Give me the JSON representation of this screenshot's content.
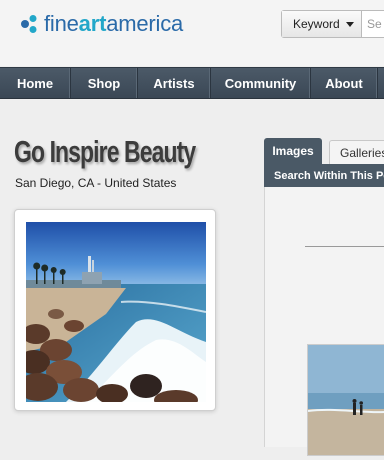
{
  "brand": {
    "part1": "fine",
    "part2": "art",
    "part3": "america",
    "colors": {
      "primary": "#2a6aa8",
      "accent": "#22a7c9"
    },
    "icon": "logo-dots-icon"
  },
  "search": {
    "dropdown_label": "Keyword",
    "dropdown_icon": "caret-down-icon",
    "placeholder": "Se"
  },
  "nav": {
    "items": [
      {
        "label": "Home"
      },
      {
        "label": "Shop"
      },
      {
        "label": "Artists"
      },
      {
        "label": "Community"
      },
      {
        "label": "About"
      }
    ],
    "bg": "#3f4c5a"
  },
  "profile": {
    "name": "Go Inspire Beauty",
    "location": "San Diego, CA - United States"
  },
  "panel": {
    "tabs": [
      {
        "label": "Images",
        "active": true
      },
      {
        "label": "Galleries",
        "active": false
      }
    ],
    "search_within": "Search Within This Po"
  }
}
